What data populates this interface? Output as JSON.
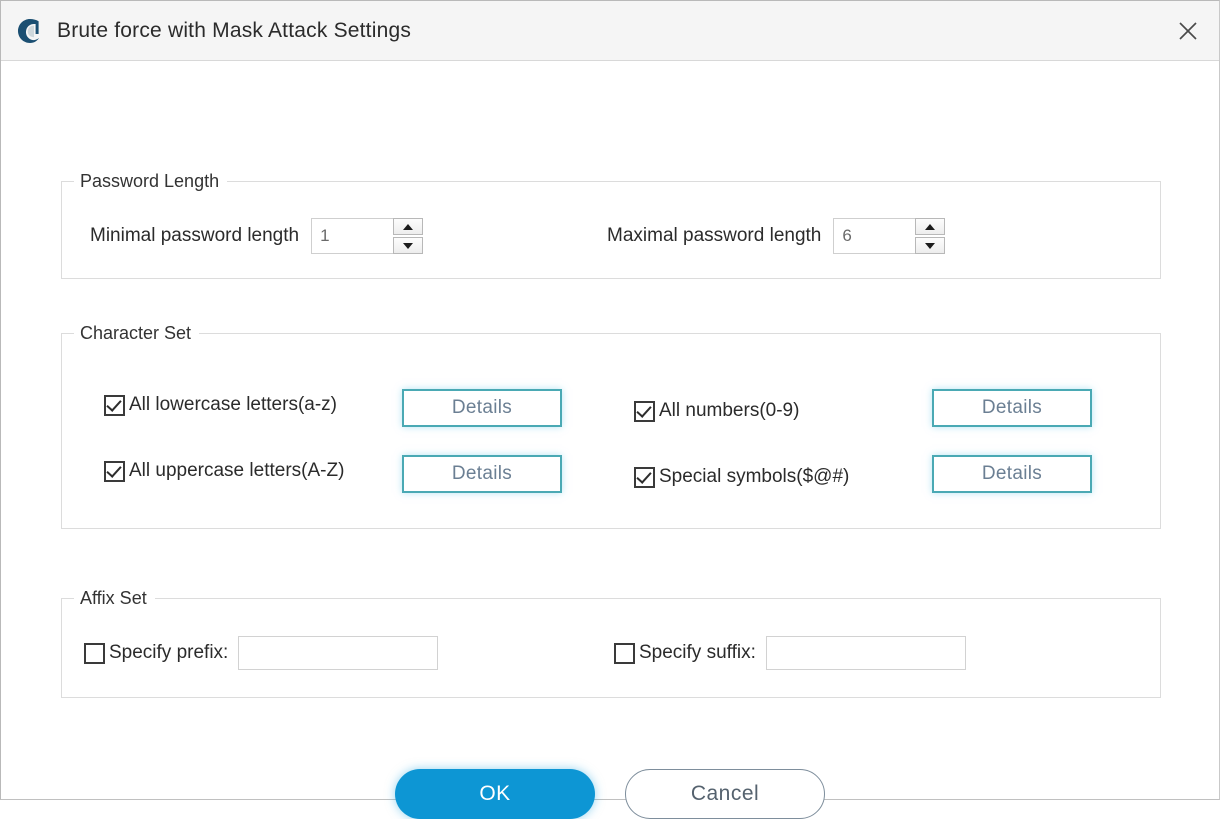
{
  "window": {
    "title": "Brute force with Mask Attack Settings",
    "app_icon": "app-logo-icon",
    "close_icon": "close-icon",
    "accent_color": "#0d96d4",
    "details_border_color": "#4aa9b4"
  },
  "password_length": {
    "legend": "Password Length",
    "minimal": {
      "label": "Minimal password length",
      "value": "1",
      "placeholder": ""
    },
    "maximal": {
      "label": "Maximal password length",
      "value": "6",
      "placeholder": ""
    }
  },
  "character_set": {
    "legend": "Character Set",
    "details_label": "Details",
    "options": [
      {
        "label": "All lowercase letters(a-z)",
        "checked": true
      },
      {
        "label": "All uppercase letters(A-Z)",
        "checked": true
      },
      {
        "label": "All numbers(0-9)",
        "checked": true
      },
      {
        "label": "Special symbols($@#)",
        "checked": true
      }
    ]
  },
  "affix_set": {
    "legend": "Affix Set",
    "prefix": {
      "label": "Specify prefix:",
      "checked": false,
      "value": "",
      "placeholder": ""
    },
    "suffix": {
      "label": "Specify suffix:",
      "checked": false,
      "value": "",
      "placeholder": ""
    }
  },
  "footer": {
    "ok_label": "OK",
    "cancel_label": "Cancel"
  }
}
